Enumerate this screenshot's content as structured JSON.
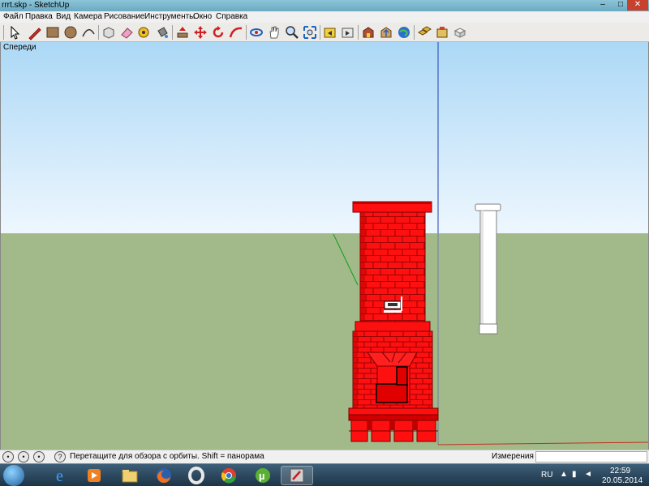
{
  "window": {
    "title": "rrrt.skp - SketchUp",
    "minimize_glyph": "–",
    "maximize_glyph": "□",
    "close_glyph": "✕"
  },
  "menu": {
    "items": [
      "Файл",
      "Правка",
      "Вид",
      "Камера",
      "Рисование",
      "Инструменты",
      "Окно",
      "Справка"
    ]
  },
  "toolbar": {
    "tools": [
      "select-icon",
      "pencil-line-icon",
      "rectangle-icon",
      "circle-icon",
      "arc-icon",
      "make-component-icon",
      "eraser-icon",
      "tape-measure-icon",
      "paint-bucket-icon",
      "push-pull-icon",
      "move-icon",
      "rotate-icon",
      "follow-me-icon",
      "orbit-icon",
      "pan-icon",
      "zoom-icon",
      "zoom-extents-icon",
      "previous-view-icon",
      "next-view-icon",
      "3d-warehouse-icon",
      "share-model-icon",
      "google-earth-icon",
      "components-icon",
      "extension-warehouse-icon",
      "layout-icon"
    ]
  },
  "viewport": {
    "scene_label": "Спереди",
    "colors": {
      "sky_top": "#acd8f6",
      "sky_bottom": "#eef7fe",
      "ground": "#a2b98a",
      "brick": "#ff1010",
      "brick_shadow": "#d00000",
      "mortar": "#7a0000",
      "pipe": "#ffffff"
    }
  },
  "status": {
    "hint": "Перетащите для обзора с орбиты.  Shift = панорама",
    "measurements_label": "Измерения",
    "measurements_value": "",
    "help_glyph": "?"
  },
  "taskbar": {
    "apps": [
      "internet-explorer-icon",
      "media-player-icon",
      "file-explorer-icon",
      "firefox-icon",
      "opera-icon",
      "chrome-icon",
      "utorrent-icon",
      "sketchup-icon"
    ],
    "language": "RU",
    "time": "22:59",
    "date": "20.05.2014"
  }
}
